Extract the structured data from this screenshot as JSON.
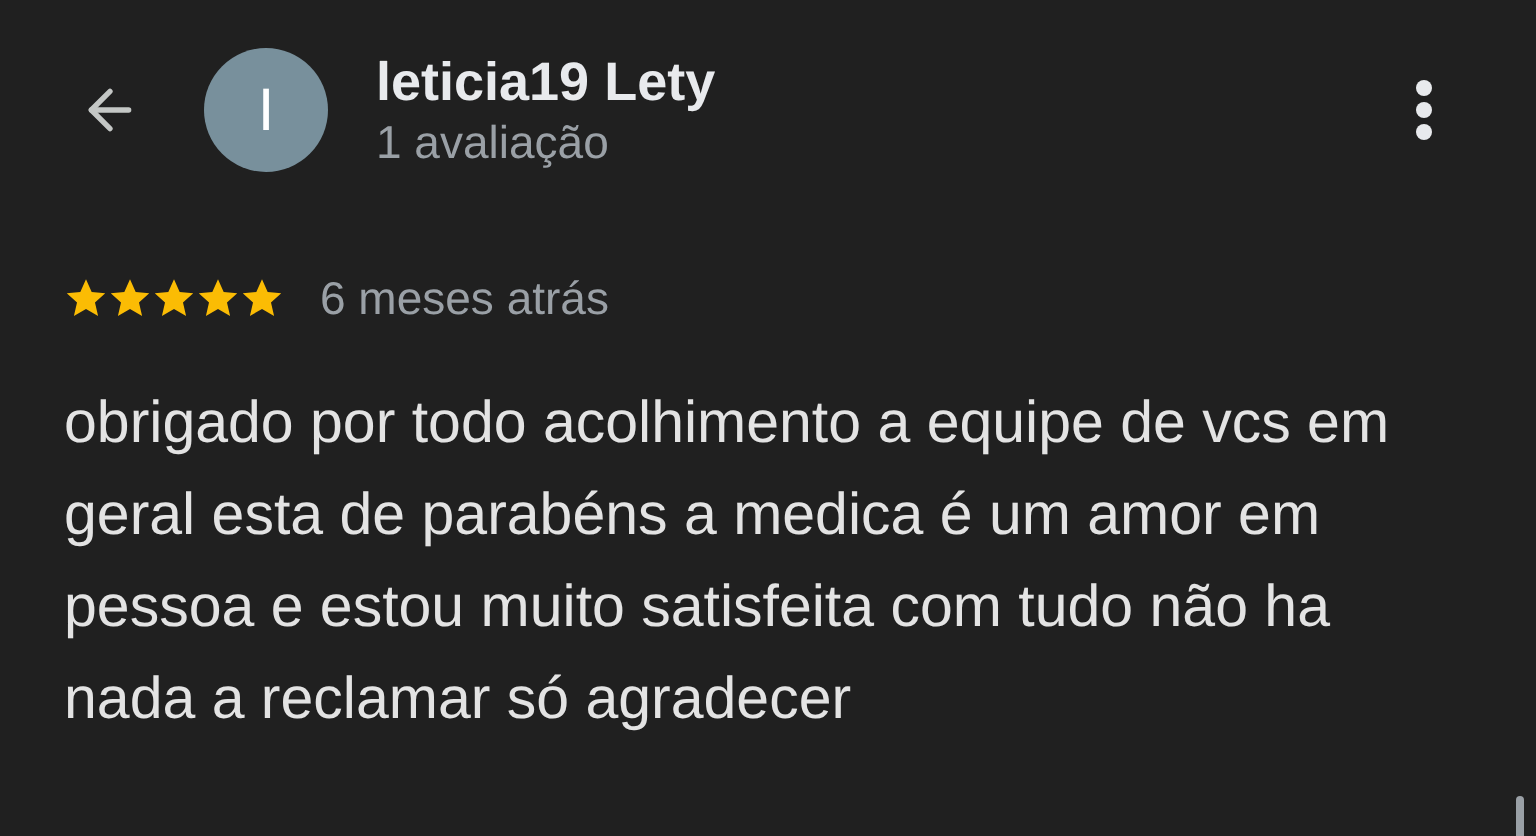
{
  "header": {
    "avatar_letter": "I",
    "name": "leticia19 Lety",
    "subtitle": "1 avaliação"
  },
  "review": {
    "stars": 5,
    "date": "6 meses atrás",
    "text": "obrigado por todo acolhimento a equipe de vcs em geral esta de parabéns a medica é um amor em pessoa e estou muito satisfeita com tudo não ha nada a reclamar só agradecer"
  }
}
